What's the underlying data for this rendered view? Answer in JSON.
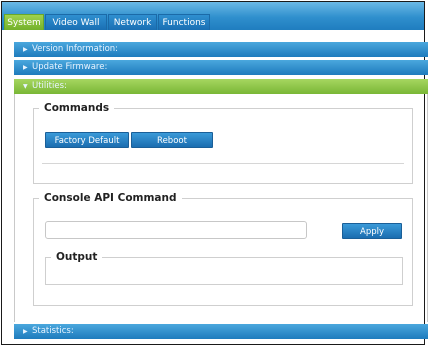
{
  "tabs": [
    {
      "label": "System",
      "active": true
    },
    {
      "label": "Video Wall",
      "active": false
    },
    {
      "label": "Network",
      "active": false
    },
    {
      "label": "Functions",
      "active": false
    }
  ],
  "sections": {
    "version": "Version Information:",
    "firmware": "Update Firmware:",
    "utilities": "Utilities:",
    "statistics": "Statistics:"
  },
  "commands": {
    "legend": "Commands",
    "factory_default": "Factory Default",
    "reboot": "Reboot"
  },
  "console": {
    "legend": "Console API Command",
    "input_value": "",
    "apply": "Apply",
    "output_legend": "Output"
  },
  "colors": {
    "accent_blue": "#1e7bbd",
    "active_green": "#79b736"
  }
}
